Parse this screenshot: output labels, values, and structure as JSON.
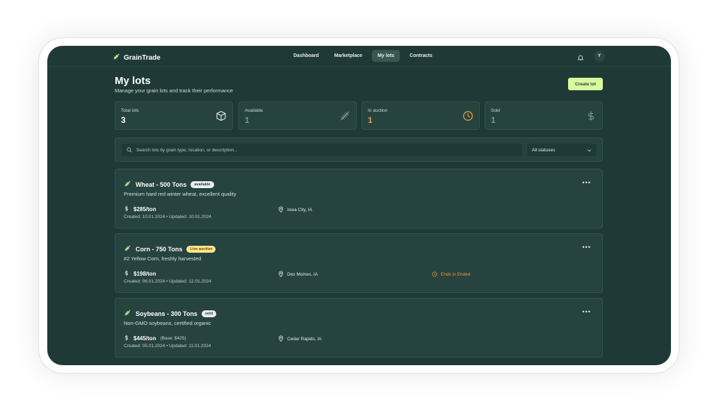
{
  "app": {
    "name": "GrainTrade",
    "nav": [
      "Dashboard",
      "Marketplace",
      "My lots",
      "Contracts"
    ],
    "active_nav": "My lots",
    "avatar_initial": "Y"
  },
  "page": {
    "title": "My lots",
    "subtitle": "Manage your grain lots and track their performance",
    "create_button": "Create lot"
  },
  "stats": [
    {
      "label": "Total lots",
      "value": "3",
      "icon": "box-icon",
      "color": "#ffffff"
    },
    {
      "label": "Available",
      "value": "1",
      "icon": "wheat-icon",
      "color": "#7d938d"
    },
    {
      "label": "In auction",
      "value": "1",
      "icon": "clock-icon",
      "color": "#f29b43"
    },
    {
      "label": "Sold",
      "value": "1",
      "icon": "dollar-icon",
      "color": "#7d938d"
    }
  ],
  "filters": {
    "search_placeholder": "Search lots by grain type, location, or description...",
    "status_value": "All statuses"
  },
  "lots": [
    {
      "title": "Wheat - 500 Tons",
      "badge": "available",
      "description": "Premium hard red winter wheat, excellent quality",
      "price": "$285/ton",
      "base_price": "",
      "location": "Iowa City, IA",
      "ends": "",
      "dates": "Created: 10.01.2024 • Updated: 10.01.2024"
    },
    {
      "title": "Corn - 750 Tons",
      "badge": "Live auction",
      "description": "#2 Yellow Corn, freshly harvested",
      "price": "$198/ton",
      "base_price": "",
      "location": "Des Moines, IA",
      "ends": "Ends in Ended",
      "dates": "Created: 08.01.2024 • Updated: 12.01.2024"
    },
    {
      "title": "Soybeans - 300 Tons",
      "badge": "sold",
      "description": "Non-GMO soybeans, certified organic",
      "price": "$445/ton",
      "base_price": "(Base: $425)",
      "location": "Cedar Rapids, IA",
      "ends": "",
      "dates": "Created: 05.01.2024 • Updated: 11.01.2024"
    }
  ],
  "colors": {
    "background": "#1f3a36",
    "card": "#27433f",
    "accent": "#d9f99d",
    "auction": "#f29b43"
  }
}
